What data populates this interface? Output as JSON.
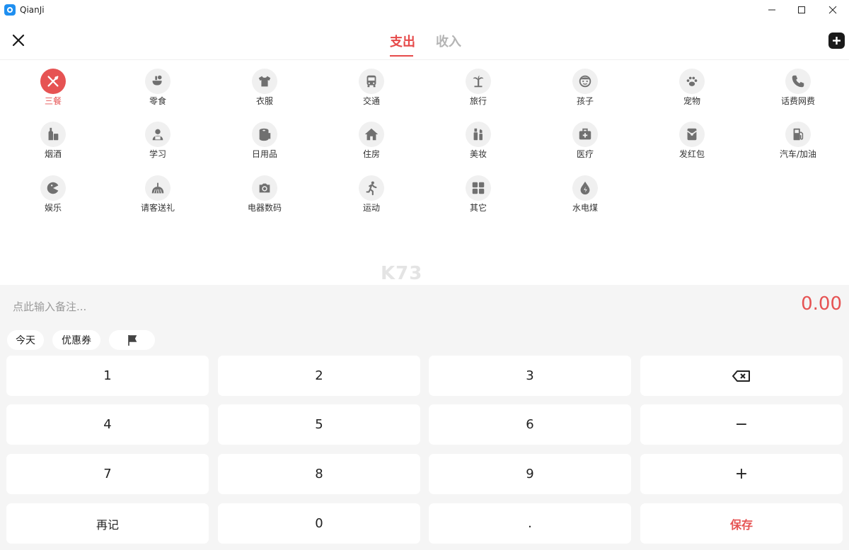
{
  "window": {
    "title": "QianJi"
  },
  "tabs": {
    "expense": "支出",
    "income": "收入"
  },
  "categories": [
    {
      "label": "三餐",
      "icon": "utensils-icon",
      "selected": true
    },
    {
      "label": "零食",
      "icon": "snack-icon"
    },
    {
      "label": "衣服",
      "icon": "shirt-icon"
    },
    {
      "label": "交通",
      "icon": "bus-icon"
    },
    {
      "label": "旅行",
      "icon": "palm-tree-icon"
    },
    {
      "label": "孩子",
      "icon": "child-face-icon"
    },
    {
      "label": "宠物",
      "icon": "paw-icon"
    },
    {
      "label": "话费网费",
      "icon": "phone-icon"
    },
    {
      "label": "烟酒",
      "icon": "bottle-icon"
    },
    {
      "label": "学习",
      "icon": "student-icon"
    },
    {
      "label": "日用品",
      "icon": "tissue-roll-icon"
    },
    {
      "label": "住房",
      "icon": "house-icon"
    },
    {
      "label": "美妆",
      "icon": "cosmetics-icon"
    },
    {
      "label": "医疗",
      "icon": "medical-kit-icon"
    },
    {
      "label": "发红包",
      "icon": "red-envelope-icon"
    },
    {
      "label": "汽车/加油",
      "icon": "gas-pump-icon"
    },
    {
      "label": "娱乐",
      "icon": "pacman-icon"
    },
    {
      "label": "请客送礼",
      "icon": "gift-icon"
    },
    {
      "label": "电器数码",
      "icon": "camera-icon"
    },
    {
      "label": "运动",
      "icon": "runner-icon"
    },
    {
      "label": "其它",
      "icon": "grid-icon"
    },
    {
      "label": "水电煤",
      "icon": "water-drop-icon"
    }
  ],
  "watermark": "K73",
  "entry": {
    "memo_placeholder": "点此输入备注...",
    "amount": "0.00"
  },
  "chips": {
    "today": "今天",
    "coupon": "优惠券"
  },
  "keypad": {
    "k1": "1",
    "k2": "2",
    "k3": "3",
    "k4": "4",
    "k5": "5",
    "k6": "6",
    "k7": "7",
    "k8": "8",
    "k9": "9",
    "again": "再记",
    "k0": "0",
    "dot": ".",
    "minus": "−",
    "plus": "+",
    "save": "保存"
  },
  "colors": {
    "accent": "#e65353",
    "inactive_tab": "#b4b4b4",
    "panel_bg": "#f5f5f5"
  }
}
